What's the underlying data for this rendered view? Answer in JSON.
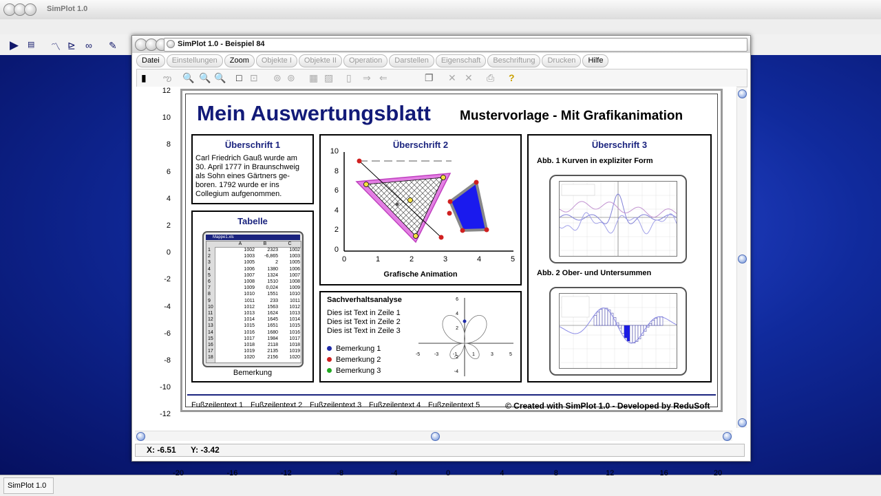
{
  "app": {
    "title": "SimPlot 1.0",
    "taskbar_label": "SimPlot 1.0"
  },
  "window": {
    "title": "SimPlot 1.0 - Beispiel 84",
    "menu": [
      {
        "label": "Datei",
        "enabled": true
      },
      {
        "label": "Einstellungen",
        "enabled": false
      },
      {
        "label": "Zoom",
        "enabled": true
      },
      {
        "label": "Objekte I",
        "enabled": false
      },
      {
        "label": "Objekte II",
        "enabled": false
      },
      {
        "label": "Operation",
        "enabled": false
      },
      {
        "label": "Darstellen",
        "enabled": false
      },
      {
        "label": "Eigenschaft",
        "enabled": false
      },
      {
        "label": "Beschriftung",
        "enabled": false
      },
      {
        "label": "Drucken",
        "enabled": false
      },
      {
        "label": "Hilfe",
        "enabled": true
      }
    ],
    "status": {
      "x": "X: -6.51",
      "y": "Y: -3.42"
    }
  },
  "axes": {
    "y_ticks": [
      "12",
      "10",
      "8",
      "6",
      "4",
      "2",
      "0",
      "-2",
      "-4",
      "-6",
      "-8",
      "-10",
      "-12"
    ],
    "x_ticks": [
      "-20",
      "-16",
      "-12",
      "-8",
      "-4",
      "0",
      "4",
      "8",
      "12",
      "16",
      "20"
    ]
  },
  "sheet": {
    "title": "Mein Auswertungsblatt",
    "subtitle": "Mustervorlage - Mit Grafikanimation",
    "box1": {
      "heading": "Überschrift 1",
      "lines": [
        "Carl Friedrich Gauß wurde am",
        "30. April 1777 in Braunschweig",
        "als Sohn eines Gärtners ge-",
        "boren. 1792 wurde er ins",
        "Collegium aufgenommen."
      ]
    },
    "table_box": {
      "heading": "Tabelle",
      "caption": "Bemerkung",
      "file": "Mappe1.xls",
      "columns": [
        "A",
        "B",
        "C"
      ],
      "rows": [
        [
          "1",
          "1002",
          "2323",
          "1002"
        ],
        [
          "2",
          "1003",
          "-6,865",
          "1003"
        ],
        [
          "3",
          "1005",
          "2",
          "1005"
        ],
        [
          "4",
          "1006",
          "1380",
          "1006"
        ],
        [
          "5",
          "1007",
          "1324",
          "1007"
        ],
        [
          "6",
          "1008",
          "1510",
          "1008"
        ],
        [
          "7",
          "1009",
          "0,024",
          "1009"
        ],
        [
          "8",
          "1010",
          "1551",
          "1010"
        ],
        [
          "9",
          "1011",
          "233",
          "1011"
        ],
        [
          "10",
          "1012",
          "1563",
          "1012"
        ],
        [
          "11",
          "1013",
          "1624",
          "1013"
        ],
        [
          "12",
          "1014",
          "1645",
          "1014"
        ],
        [
          "13",
          "1015",
          "1651",
          "1015"
        ],
        [
          "14",
          "1016",
          "1680",
          "1016"
        ],
        [
          "15",
          "1017",
          "1984",
          "1017"
        ],
        [
          "16",
          "1018",
          "2118",
          "1018"
        ],
        [
          "17",
          "1019",
          "2135",
          "1019"
        ],
        [
          "18",
          "1020",
          "2156",
          "1020"
        ]
      ]
    },
    "box2": {
      "heading": "Überschrift 2",
      "xlabel": "Grafische Animation",
      "x_ticks": [
        "0",
        "1",
        "2",
        "3",
        "4",
        "5"
      ],
      "y_ticks": [
        "0",
        "2",
        "4",
        "6",
        "8",
        "10"
      ]
    },
    "analysis": {
      "heading": "Sachverhaltsanalyse",
      "lines": [
        "Dies ist Text in Zeile 1",
        "Dies ist Text in Zeile 2",
        "Dies ist Text in Zeile 3"
      ],
      "legend": [
        {
          "label": "Bemerkung 1",
          "color": "#1f2aa8"
        },
        {
          "label": "Bemerkung 2",
          "color": "#d02020"
        },
        {
          "label": "Bemerkung 3",
          "color": "#22aa22"
        }
      ],
      "polar_x_ticks": [
        "-5",
        "-3",
        "-1",
        "1",
        "3",
        "5"
      ],
      "polar_y_ticks": [
        "6",
        "4",
        "2",
        "-2",
        "-4"
      ]
    },
    "box3": {
      "heading": "Überschrift 3",
      "fig1": "Abb. 1  Kurven in expliziter Form",
      "fig2": "Abb. 2  Ober- und Untersummen"
    },
    "footer": {
      "items": [
        "Fußzeilentext 1",
        "Fußzeilentext 2",
        "Fußzeilentext 3",
        "Fußzeilentext 4",
        "Fußzeilentext 5"
      ],
      "credit": "© Created with SimPlot 1.0 - Developed by ReduSoft"
    }
  },
  "colors": {
    "accent": "#1a237e",
    "triangle_fill": "#e37fe3",
    "polygon_fill": "#1a1aee"
  }
}
